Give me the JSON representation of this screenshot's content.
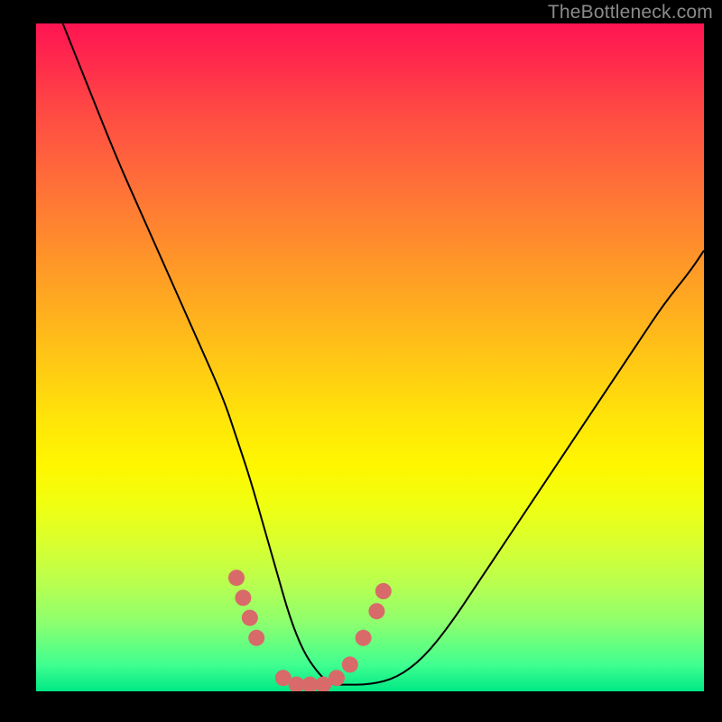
{
  "watermark": "TheBottleneck.com",
  "colors": {
    "curve_stroke": "#000000",
    "marker_fill": "#d86a6a",
    "marker_stroke": "#d86a6a",
    "frame_bg": "#000000"
  },
  "chart_data": {
    "type": "line",
    "title": "",
    "xlabel": "",
    "ylabel": "",
    "xlim": [
      0,
      100
    ],
    "ylim": [
      0,
      100
    ],
    "grid": false,
    "series": [
      {
        "name": "bottleneck-curve",
        "x": [
          4,
          8,
          12,
          16,
          20,
          24,
          28,
          30,
          32,
          34,
          36,
          38,
          40,
          42,
          44,
          46,
          50,
          54,
          58,
          62,
          66,
          70,
          74,
          78,
          82,
          86,
          90,
          94,
          98,
          100
        ],
        "y": [
          100,
          90,
          80,
          71,
          62,
          53,
          44,
          38,
          32,
          25,
          18,
          11,
          6,
          3,
          1,
          1,
          1,
          2,
          5,
          10,
          16,
          22,
          28,
          34,
          40,
          46,
          52,
          58,
          63,
          66
        ]
      }
    ],
    "markers": [
      {
        "x": 30,
        "y": 17
      },
      {
        "x": 31,
        "y": 14
      },
      {
        "x": 32,
        "y": 11
      },
      {
        "x": 33,
        "y": 8
      },
      {
        "x": 37,
        "y": 2
      },
      {
        "x": 39,
        "y": 1
      },
      {
        "x": 41,
        "y": 1
      },
      {
        "x": 43,
        "y": 1
      },
      {
        "x": 45,
        "y": 2
      },
      {
        "x": 47,
        "y": 4
      },
      {
        "x": 49,
        "y": 8
      },
      {
        "x": 51,
        "y": 12
      },
      {
        "x": 52,
        "y": 15
      }
    ]
  }
}
